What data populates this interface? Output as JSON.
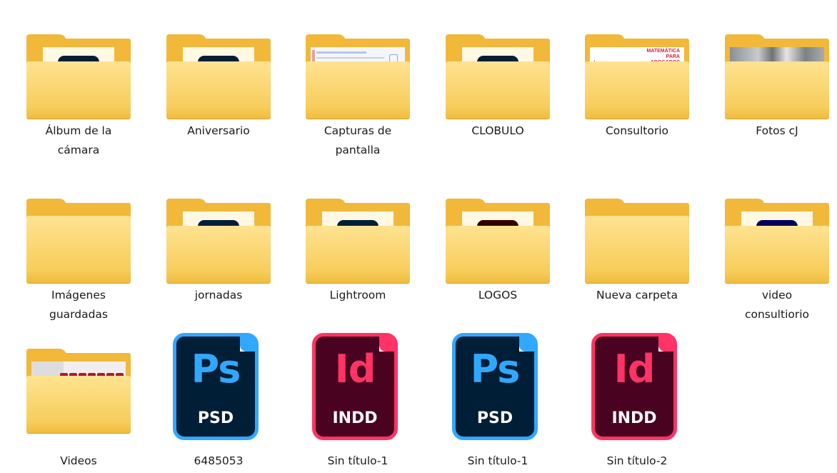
{
  "window": {
    "view": "Large icons"
  },
  "colors": {
    "ps": "#31a8ff",
    "ps_bg": "#001e36",
    "ai": "#ff9a00",
    "ai_bg": "#330000",
    "lrc": "#31a8ff",
    "lrc_bg": "#001e36",
    "pr": "#9999ff",
    "pr_bg": "#00005b",
    "id": "#ff3366",
    "id_bg": "#49021f",
    "folder": "#f7cd5b"
  },
  "items": [
    {
      "label": "Álbum de la\ncámara",
      "type": "folder",
      "badge": "Ps",
      "icon": "photoshop-icon"
    },
    {
      "label": "Aniversario",
      "type": "folder",
      "badge": "Ps",
      "icon": "photoshop-icon"
    },
    {
      "label": "Capturas de\npantalla",
      "type": "folder",
      "preview": "screenshot"
    },
    {
      "label": "CLOBULO",
      "type": "folder",
      "badge": "Ps",
      "icon": "photoshop-icon"
    },
    {
      "label": "Consultorio",
      "type": "folder",
      "preview": "document",
      "preview_lines": [
        "MATEMÁTICA",
        "PARA",
        "ABOGADOS"
      ]
    },
    {
      "label": "Fotos cJ",
      "type": "folder",
      "preview": "photo"
    },
    {
      "label": "Imágenes\nguardadas",
      "type": "folder"
    },
    {
      "label": "jornadas",
      "type": "folder",
      "badge": "Ps",
      "icon": "photoshop-icon"
    },
    {
      "label": "Lightroom",
      "type": "folder",
      "badge": "LrC",
      "icon": "lightroom-icon"
    },
    {
      "label": "LOGOS",
      "type": "folder",
      "badge": "Ai",
      "icon": "illustrator-icon"
    },
    {
      "label": "Nueva carpeta",
      "type": "folder"
    },
    {
      "label": "video\nconsultiorio",
      "type": "folder",
      "badge": "Pr",
      "icon": "premiere-icon"
    },
    {
      "label": "Videos",
      "type": "folder",
      "preview": "keyboard"
    },
    {
      "label": "6485053",
      "type": "file",
      "app": "Ps",
      "ext": "PSD",
      "icon": "psd-file-icon"
    },
    {
      "label": "Sin título-1",
      "type": "file",
      "app": "Id",
      "ext": "INDD",
      "icon": "indd-file-icon"
    },
    {
      "label": "Sin título-1",
      "type": "file",
      "app": "Ps",
      "ext": "PSD",
      "icon": "psd-file-icon"
    },
    {
      "label": "Sin título-2",
      "type": "file",
      "app": "Id",
      "ext": "INDD",
      "icon": "indd-file-icon"
    }
  ]
}
